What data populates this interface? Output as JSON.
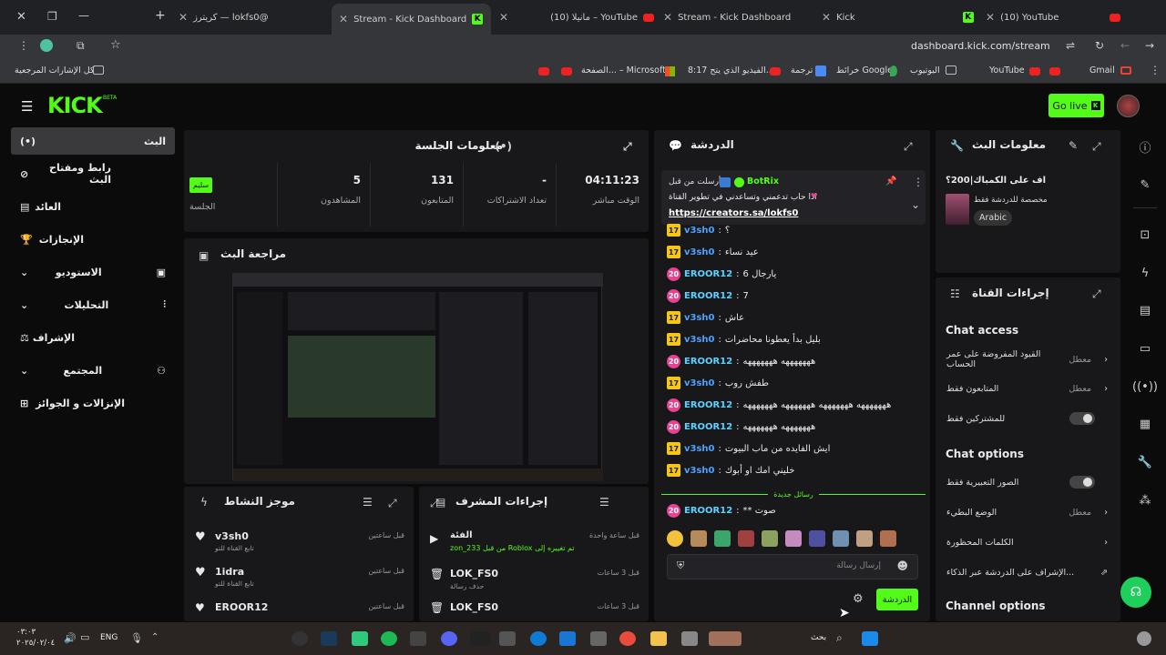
{
  "browser": {
    "tabs": [
      {
        "label": "كريترز — lokfs0@"
      },
      {
        "label": "Stream - Kick Dashboard"
      },
      {
        "label": "(10) مانيلا – YouTube"
      },
      {
        "label": "Stream - Kick Dashboard"
      },
      {
        "label": "Kick"
      },
      {
        "label": "(10) YouTube"
      }
    ],
    "url": "dashboard.kick.com/stream",
    "bookmarks": [
      "كل الإشارات المرجعية",
      "الصفحة... – Microsoft",
      "8:17 الفيديو الذي يتح...",
      "ترجمة",
      "خرائط Google",
      "اليوتيوب",
      "YouTube",
      "Gmail"
    ]
  },
  "header": {
    "logo": "KICK",
    "beta": "BETA",
    "go_live": "Go live"
  },
  "sidebar": {
    "items": [
      {
        "label": "البث"
      },
      {
        "label": "رابط ومفتاح البث"
      },
      {
        "label": "العائد"
      },
      {
        "label": "الإنجازات"
      },
      {
        "label": "الاستوديو"
      },
      {
        "label": "التحليلات"
      },
      {
        "label": "الإشراف"
      },
      {
        "label": "المجتمع"
      },
      {
        "label": "الإنزالات و الجوائز"
      }
    ]
  },
  "session": {
    "title": "معلومات الجلسة",
    "stats": [
      {
        "value": "04:11:23",
        "label": "الوقت مباشر"
      },
      {
        "value": "-",
        "label": "تعداد الاشتراكات"
      },
      {
        "value": "131",
        "label": "المتابعون"
      },
      {
        "value": "5",
        "label": "المشاهدون"
      },
      {
        "value": "سليم",
        "label": "الجلسة"
      }
    ]
  },
  "preview": {
    "title": "مراجعة البث"
  },
  "activity": {
    "title": "موجز النشاط",
    "items": [
      {
        "user": "v3sh0",
        "sub": "تابع القناة للتو",
        "time": "قبل ساعتين"
      },
      {
        "user": "1idra",
        "sub": "تابع القناة للتو",
        "time": "قبل ساعتين"
      },
      {
        "user": "EROOR12",
        "sub": "",
        "time": "قبل ساعتين"
      }
    ]
  },
  "modlog": {
    "title": "إجراءات المشرف",
    "items": [
      {
        "title": "الفئة",
        "desc": "zon_233 من قبل Roblox تم تغييره إلى",
        "time": "قبل ساعة واحدة"
      },
      {
        "title": "LOK_FS0",
        "desc": "حذف رسالة",
        "time": "قبل 3 ساعات"
      },
      {
        "title": "LOK_FS0",
        "desc": "",
        "time": "قبل 3 ساعات"
      }
    ]
  },
  "chat": {
    "title": "الدردشة",
    "pinned": {
      "by": "أرسلت من قبل",
      "user": "BotRix",
      "text": "اذا حاب تدعمني وتساعدني في تطوير القناة",
      "link": "https://creators.sa/lokfs0"
    },
    "messages": [
      {
        "badge": "17",
        "user": "v3sh0",
        "text": "؟"
      },
      {
        "badge": "17",
        "user": "v3sh0",
        "text": "عيد نساء"
      },
      {
        "badge": "20",
        "user": "EROOR12",
        "text": "يارجال 6"
      },
      {
        "badge": "20",
        "user": "EROOR12",
        "text": "7"
      },
      {
        "badge": "17",
        "user": "v3sh0",
        "text": "عاش"
      },
      {
        "badge": "17",
        "user": "v3sh0",
        "text": "بليل بدأ يعطونا محاضرات"
      },
      {
        "badge": "20",
        "user": "EROOR12",
        "text": "هههههههه هههههههه"
      },
      {
        "badge": "17",
        "user": "v3sh0",
        "text": "طفش روب"
      },
      {
        "badge": "20",
        "user": "EROOR12",
        "text": "هههههههه هههههههه هههههههه هههههههه"
      },
      {
        "badge": "20",
        "user": "EROOR12",
        "text": "هههههههه هههههههه"
      },
      {
        "badge": "17",
        "user": "v3sh0",
        "text": "ايش الفايده من ماب البيوت"
      },
      {
        "badge": "17",
        "user": "v3sh0",
        "text": "خليني امك او أبوك"
      }
    ],
    "new_messages": "رسائل جديدة",
    "last": {
      "badge": "20",
      "user": "EROOR12",
      "text": "** صوت"
    },
    "input_placeholder": "إرسال رسالة",
    "send": "الدردشة"
  },
  "stream_info": {
    "title": "معلومات البث",
    "stream_title": "اف على الكمباك|200؟",
    "desc": "مخصصة للدردشة فقط",
    "lang": "Arabic"
  },
  "channel_actions": {
    "title": "إجراءات القناة",
    "chat_access": "Chat access",
    "access_rows": [
      {
        "label": "القيود المفروضة على عمر الحساب",
        "value": "معطل"
      },
      {
        "label": "المتابعون فقط",
        "value": "معطل"
      },
      {
        "label": "للمشتركين فقط",
        "value": ""
      }
    ],
    "chat_options": "Chat options",
    "option_rows": [
      {
        "label": "الصور التعبيرية فقط",
        "value": ""
      },
      {
        "label": "الوضع البطيء",
        "value": "معطل"
      },
      {
        "label": "الكلمات المحظورة",
        "value": ""
      },
      {
        "label": "الإشراف على الدردشة عبر الذكاء...",
        "value": ""
      }
    ],
    "channel_options": "Channel options"
  },
  "taskbar": {
    "time": "٠٣:٠٣",
    "date": "٢٠٢٥/٠٢/٠٤",
    "lang": "ENG",
    "search": "بحث"
  },
  "colors": {
    "kick_green": "#53fc18",
    "panel": "#18181b",
    "bg": "#0b0b0c"
  }
}
